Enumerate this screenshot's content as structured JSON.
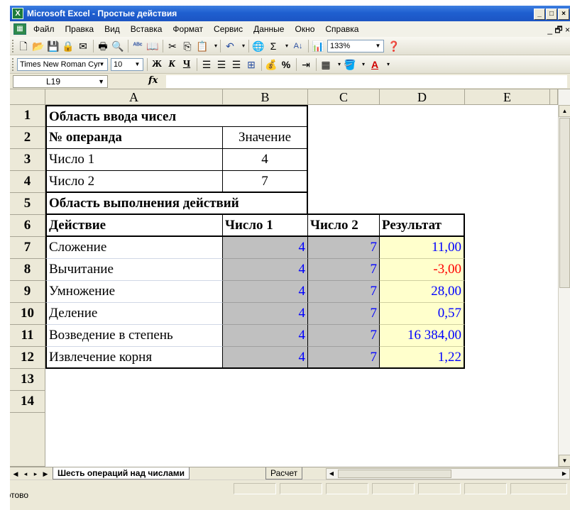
{
  "window": {
    "title": "Microsoft Excel - Простые действия",
    "controls": [
      "_",
      "□",
      "×"
    ],
    "doc_controls": [
      "_",
      "🗗",
      "×"
    ]
  },
  "menu": [
    "Файл",
    "Правка",
    "Вид",
    "Вставка",
    "Формат",
    "Сервис",
    "Данные",
    "Окно",
    "Справка"
  ],
  "toolbar": {
    "zoom": "133%",
    "font_name": "Times New Roman Cyr",
    "font_size": "10",
    "bold_label": "Ж",
    "italic_label": "К",
    "underline_label": "Ч",
    "percent_label": "%",
    "sum_label": "Σ",
    "icons": [
      "new-icon",
      "open-icon",
      "save-icon",
      "permission-icon",
      "print-icon",
      "print-preview-icon",
      "spelling-icon",
      "research-icon",
      "cut-icon",
      "copy-icon",
      "paste-icon",
      "undo-icon",
      "hyperlink-icon",
      "autosum-icon",
      "sort-icon",
      "chart-icon",
      "help-icon"
    ]
  },
  "formula_bar": {
    "cell_ref": "L19",
    "fx_label": "fx",
    "value": ""
  },
  "columns": [
    "A",
    "B",
    "C",
    "D",
    "E"
  ],
  "rows": [
    "1",
    "2",
    "3",
    "4",
    "5",
    "6",
    "7",
    "8",
    "9",
    "10",
    "11",
    "12",
    "13",
    "14"
  ],
  "cells": {
    "A1": "Область ввода чисел",
    "A2": "№ операнда",
    "B2": "Значение",
    "A3": "Число 1",
    "B3": "4",
    "A4": "Число 2",
    "B4": "7",
    "A5": "Область выполнения действий",
    "A6": "Действие",
    "B6": "Число 1",
    "C6": "Число 2",
    "D6": "Результат",
    "A7": "Сложение",
    "B7": "4",
    "C7": "7",
    "D7": "11,00",
    "A8": "Вычитание",
    "B8": "4",
    "C8": "7",
    "D8": "-3,00",
    "A9": "Умножение",
    "B9": "4",
    "C9": "7",
    "D9": "28,00",
    "A10": "Деление",
    "B10": "4",
    "C10": "7",
    "D10": "0,57",
    "A11": "Возведение в степень",
    "B11": "4",
    "C11": "7",
    "D11": "16 384,00",
    "A12": "Извлечение корня",
    "B12": "4",
    "C12": "7",
    "D12": "1,22"
  },
  "sheet_tabs": [
    "Шесть операций над числами",
    "Расчет"
  ],
  "status": "Готово",
  "colors": {
    "title_bar": "#1f5fd0",
    "input_gray": "#c0c0c0",
    "result_yellow": "#ffffcc",
    "value_blue": "#0000ff",
    "negative_red": "#ff0000"
  }
}
